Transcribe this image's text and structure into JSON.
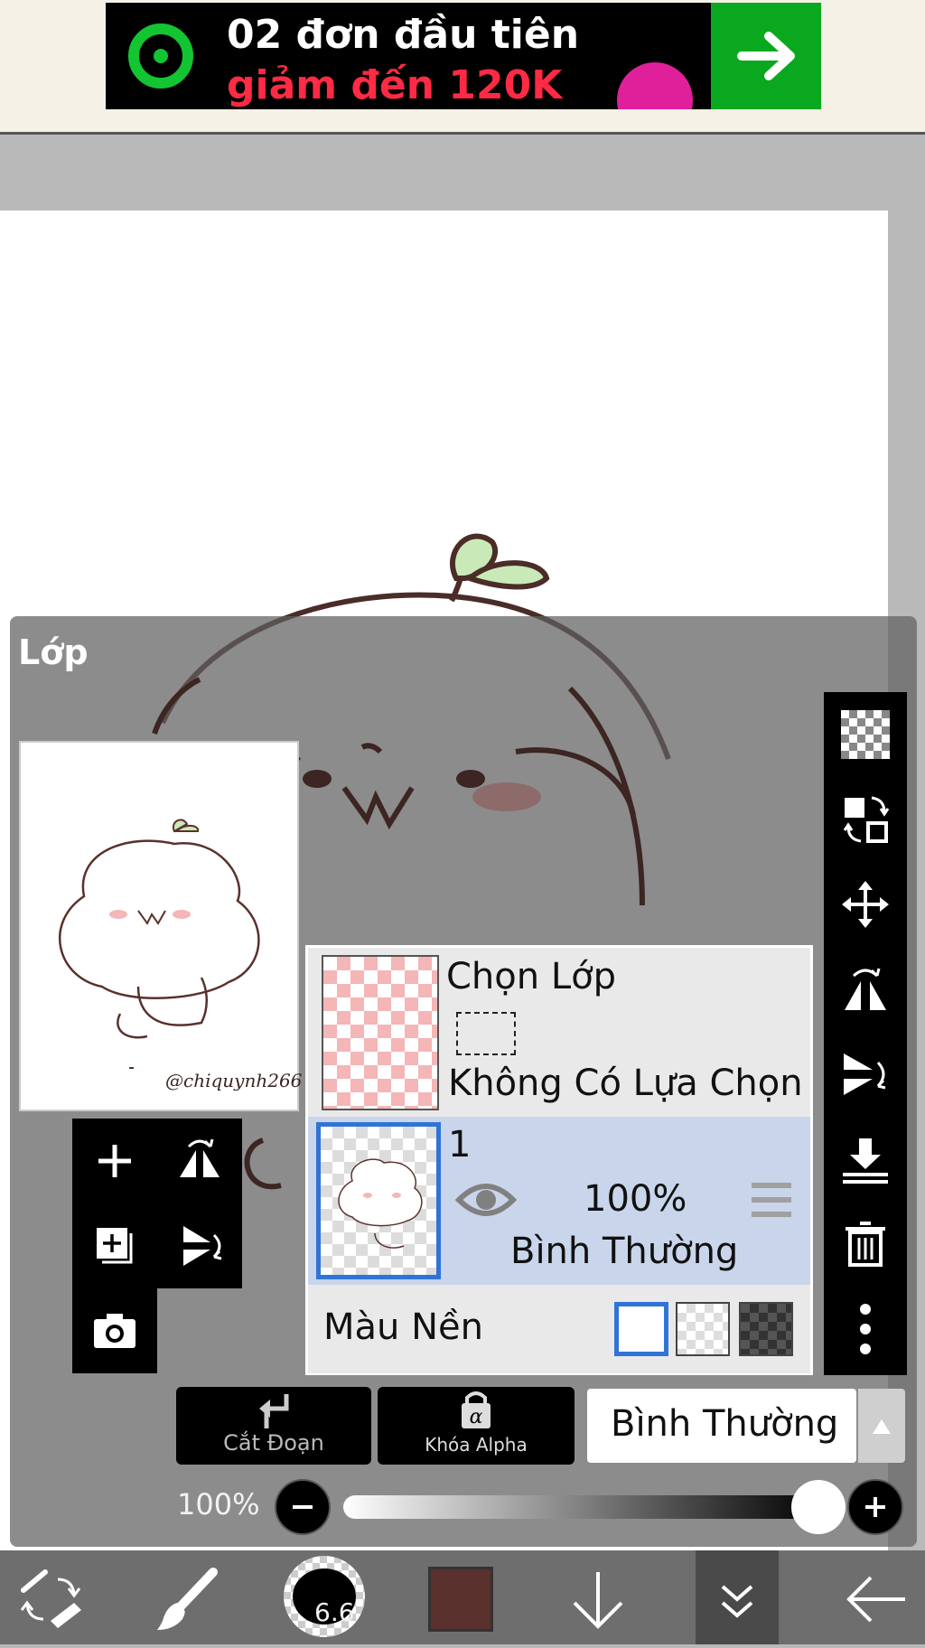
{
  "ad": {
    "line1": "02 đơn đầu tiên",
    "line2": "giảm đến 120K"
  },
  "layer_panel": {
    "title": "Lớp",
    "preview_signature": "@chiquynh266",
    "selection_layer": {
      "name": "Chọn Lớp",
      "status": "Không Có Lựa Chọn"
    },
    "layer1": {
      "name": "1",
      "opacity": "100%",
      "blend": "Bình Thường"
    },
    "background": {
      "label": "Màu Nền"
    },
    "buttons": {
      "clip": "Cắt Đoạn",
      "alpha_lock": "Khóa Alpha"
    },
    "blend_mode": "Bình Thường",
    "opacity_label": "100%",
    "opacity_value": 1.0
  },
  "bottom_toolbar": {
    "brush_size": "6.6",
    "color": "#5a312c"
  },
  "colors": {
    "selected_blue": "#2f74d6",
    "ad_green": "#0aa81e",
    "ad_red": "#ff2a44"
  }
}
